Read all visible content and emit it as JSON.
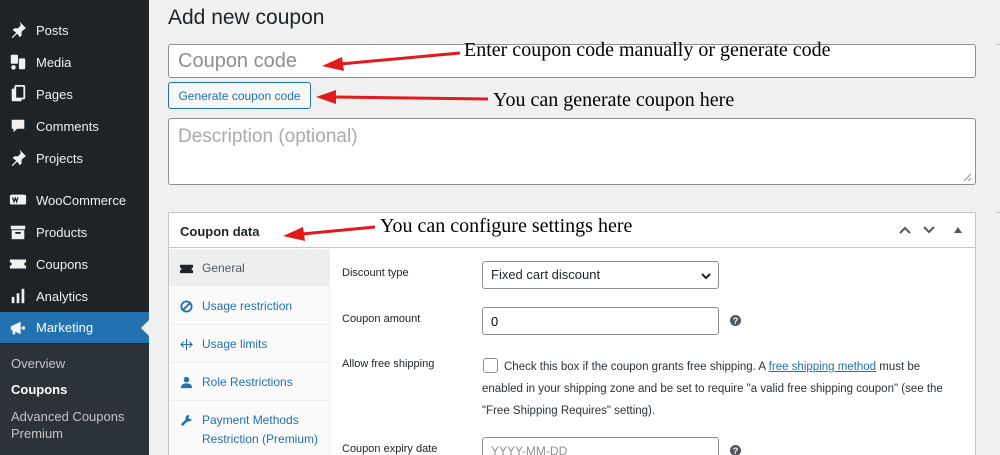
{
  "sidebar": {
    "items": [
      {
        "label": "Posts",
        "icon": "pin-icon"
      },
      {
        "label": "Media",
        "icon": "media-icon"
      },
      {
        "label": "Pages",
        "icon": "pages-icon"
      },
      {
        "label": "Comments",
        "icon": "comment-icon"
      },
      {
        "label": "Projects",
        "icon": "pin-icon"
      },
      {
        "label": "WooCommerce",
        "icon": "woo-icon"
      },
      {
        "label": "Products",
        "icon": "archive-icon"
      },
      {
        "label": "Coupons",
        "icon": "ticket-icon"
      },
      {
        "label": "Analytics",
        "icon": "bar-chart-icon"
      },
      {
        "label": "Marketing",
        "icon": "megaphone-icon"
      }
    ],
    "active": "Marketing",
    "submenu": [
      {
        "label": "Overview"
      },
      {
        "label": "Coupons"
      },
      {
        "label": "Advanced Coupons Premium"
      }
    ],
    "current_submenu": "Coupons"
  },
  "main": {
    "title": "Add new coupon",
    "coupon_code_placeholder": "Coupon code",
    "generate_button": "Generate coupon code",
    "description_placeholder": "Description (optional)",
    "panel": {
      "title": "Coupon data",
      "tabs": [
        {
          "label": "General",
          "icon": "ticket-icon"
        },
        {
          "label": "Usage restriction",
          "icon": "block-icon"
        },
        {
          "label": "Usage limits",
          "icon": "limits-icon"
        },
        {
          "label": "Role Restrictions",
          "icon": "user-icon"
        },
        {
          "label": "Payment Methods Restriction (Premium)",
          "icon": "wrench-icon"
        }
      ],
      "fields": {
        "discount_type": {
          "label": "Discount type",
          "value": "Fixed cart discount"
        },
        "coupon_amount": {
          "label": "Coupon amount",
          "value": "0"
        },
        "free_shipping": {
          "label": "Allow free shipping",
          "text_before": "Check this box if the coupon grants free shipping. A ",
          "link": "free shipping method",
          "text_after": " must be enabled in your shipping zone and be set to require \"a valid free shipping coupon\" (see the \"Free Shipping Requires\" setting).",
          "checked": false
        },
        "expiry_date": {
          "label": "Coupon expiry date",
          "placeholder": "YYYY-MM-DD"
        }
      }
    }
  },
  "annotations": [
    "Enter coupon code manually or generate code",
    "You can generate coupon here",
    "You can configure settings here"
  ],
  "colors": {
    "sidebar_bg": "#1d2327",
    "accent": "#2271b1",
    "arrow": "#e11b1b"
  }
}
